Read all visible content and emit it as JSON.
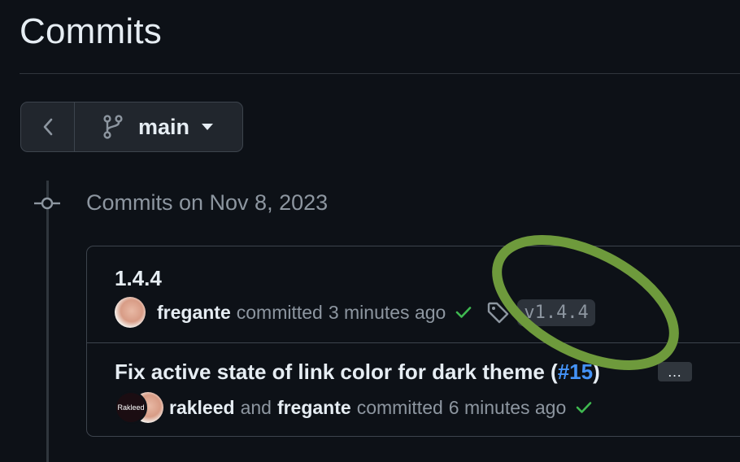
{
  "page": {
    "title": "Commits"
  },
  "branch": {
    "name": "main"
  },
  "timeline": {
    "date_heading": "Commits on Nov 8, 2023"
  },
  "commits": [
    {
      "title": "1.4.4",
      "author": "fregante",
      "committed_text": "committed",
      "time": "3 minutes ago",
      "status": "success",
      "tag": "v1.4.4"
    },
    {
      "title_prefix": "Fix active state of link color for dark theme (",
      "pr": "#15",
      "title_suffix": ")",
      "ellipsis": "…",
      "author": "rakleed",
      "and_text": "and",
      "coauthor": "fregante",
      "committed_text": "committed",
      "time": "6 minutes ago",
      "status": "success",
      "avatar_text": "Rakleed"
    }
  ],
  "colors": {
    "background": "#0d1117",
    "text": "#e6edf3",
    "muted": "#8d96a0",
    "success": "#3fb950",
    "link": "#4493f8",
    "annotation": "#6e9a3c"
  },
  "icons": {
    "back": "chevron-left-icon",
    "branch": "git-branch-icon",
    "caret": "triangle-down-icon",
    "commit_node": "git-commit-icon",
    "check": "check-icon",
    "tag": "tag-icon"
  }
}
